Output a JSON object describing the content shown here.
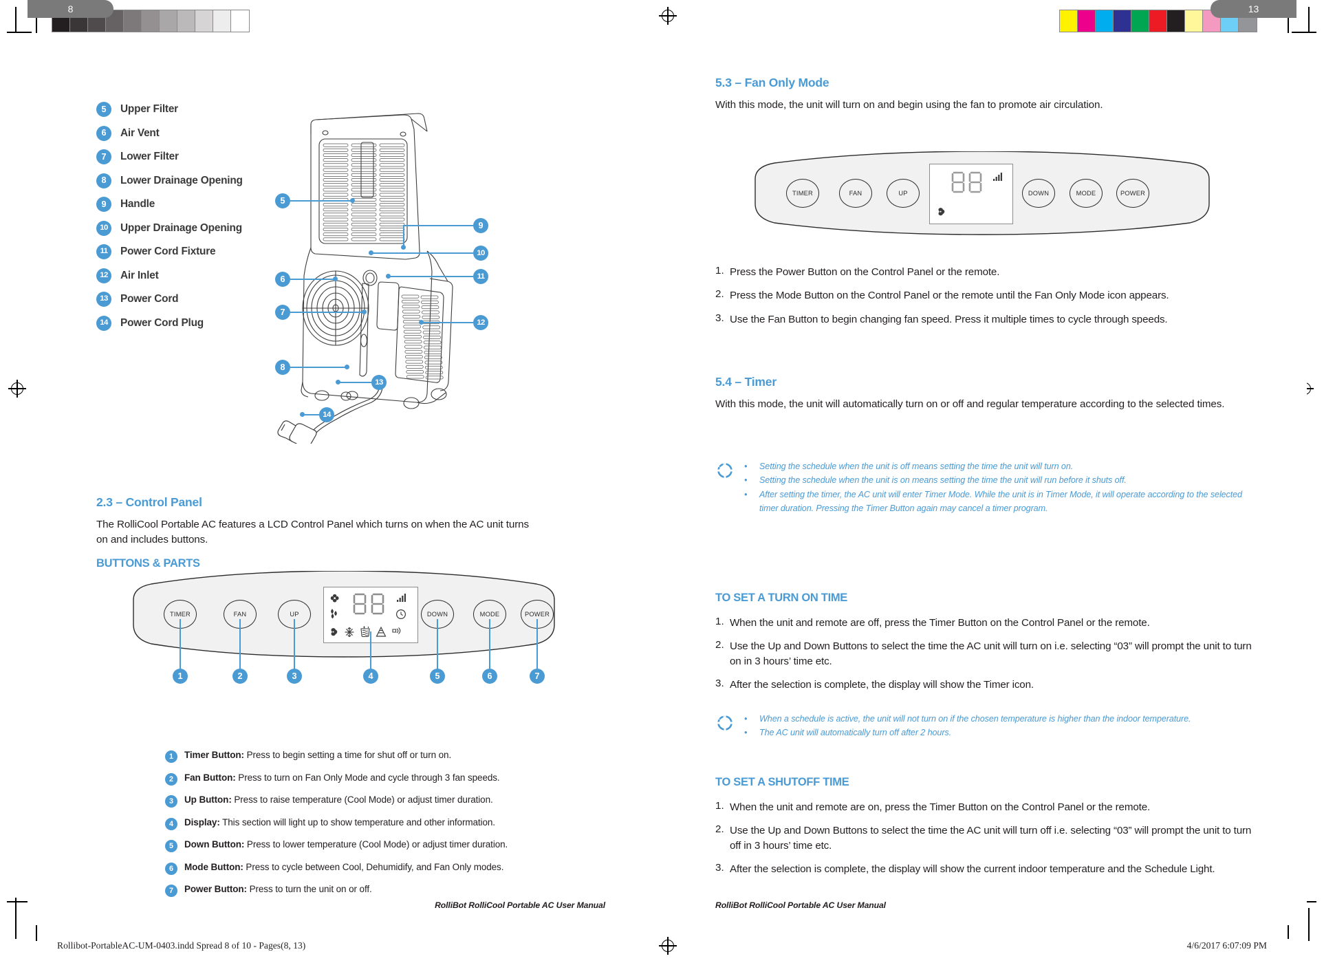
{
  "document": {
    "manual_name": "RolliBot RolliCool Portable AC User Manual",
    "left_page_number": "8",
    "right_page_number": "13",
    "print_file": "Rollibot-PortableAC-UM-0403.indd   Spread 8 of 10 - Pages(8, 13)",
    "print_timestamp": "4/6/2017   6:07:09 PM",
    "accent_color": "#4a9ad4",
    "text_color": "#231f20"
  },
  "press_marks": {
    "gray_swatches": [
      "#231f20",
      "#3a3637",
      "#4f4b4c",
      "#666263",
      "#7d797a",
      "#949091",
      "#aaa7a8",
      "#bcb9ba",
      "#d6d4d5",
      "#eeedee",
      "#ffffff"
    ],
    "color_swatches": [
      "#fff200",
      "#ec008c",
      "#00aeef",
      "#2e3192",
      "#00a651",
      "#ed1c24",
      "#231f20",
      "#fff799",
      "#f49ac1",
      "#6dcff6",
      "#939598"
    ]
  },
  "left_page": {
    "parts_list": [
      {
        "num": "5",
        "label": "Upper Filter"
      },
      {
        "num": "6",
        "label": "Air Vent"
      },
      {
        "num": "7",
        "label": "Lower Filter"
      },
      {
        "num": "8",
        "label": "Lower Drainage Opening"
      },
      {
        "num": "9",
        "label": "Handle"
      },
      {
        "num": "10",
        "label": "Upper Drainage Opening"
      },
      {
        "num": "11",
        "label": "Power Cord Fixture"
      },
      {
        "num": "12",
        "label": "Air Inlet"
      },
      {
        "num": "13",
        "label": "Power Cord"
      },
      {
        "num": "14",
        "label": "Power Cord Plug"
      }
    ],
    "diagram_callouts": [
      "5",
      "6",
      "7",
      "8",
      "9",
      "10",
      "11",
      "12",
      "13",
      "14"
    ],
    "section": {
      "heading": "2.3 – Control Panel",
      "intro": "The RolliCool Portable AC features a LCD Control Panel which turns on when the AC unit turns on and includes buttons.",
      "subheading": "BUTTONS & PARTS"
    },
    "control_panel": {
      "buttons": [
        "TIMER",
        "FAN",
        "UP",
        "DOWN",
        "MODE",
        "POWER"
      ],
      "display_digits": "88",
      "callout_numbers": [
        "1",
        "2",
        "3",
        "4",
        "5",
        "6",
        "7"
      ],
      "display_icons_top": [
        "fan-icon",
        "droplet-icon",
        "signal-bars-icon",
        "clock-icon"
      ],
      "display_icons_bottom": [
        "fan-mode-icon",
        "snowflake-icon",
        "dehumidify-icon",
        "filter-icon",
        "sleep-icon"
      ]
    },
    "legend": [
      {
        "num": "1",
        "title": "Timer Button:",
        "desc": " Press to begin setting a time for shut off or turn on."
      },
      {
        "num": "2",
        "title": "Fan Button:",
        "desc": " Press to turn on Fan Only Mode and cycle through 3 fan speeds."
      },
      {
        "num": "3",
        "title": "Up Button:",
        "desc": " Press to raise temperature (Cool Mode) or adjust timer duration."
      },
      {
        "num": "4",
        "title": "Display:",
        "desc": " This section will light up to show temperature and other information."
      },
      {
        "num": "5",
        "title": "Down Button:",
        "desc": " Press to lower temperature (Cool Mode) or adjust timer duration."
      },
      {
        "num": "6",
        "title": "Mode Button:",
        "desc": " Press to cycle between Cool, Dehumidify, and Fan Only modes."
      },
      {
        "num": "7",
        "title": "Power Button:",
        "desc": " Press to turn the unit on or off."
      }
    ]
  },
  "right_page": {
    "fan_only": {
      "heading": "5.3 – Fan Only Mode",
      "intro": "With this mode, the unit will turn on and begin using the fan to promote air circulation.",
      "panel": {
        "buttons": [
          "TIMER",
          "FAN",
          "UP",
          "DOWN",
          "MODE",
          "POWER"
        ],
        "display_digits": "88",
        "display_icons": [
          "signal-bars-icon",
          "fan-mode-icon"
        ]
      },
      "steps": [
        {
          "num": "1.",
          "text": "Press the Power Button on the Control Panel or the remote."
        },
        {
          "num": "2.",
          "text": "Press the Mode Button on the Control Panel or the remote until the Fan Only Mode icon appears."
        },
        {
          "num": "3.",
          "text": "Use the Fan Button to begin changing fan speed. Press it multiple times to cycle through speeds."
        }
      ]
    },
    "timer": {
      "heading": "5.4 – Timer",
      "intro": "With this mode, the unit will automatically turn on or off and regular temperature according to the selected times.",
      "notes": [
        "Setting the schedule when the unit is off means setting the time the unit will turn on.",
        " Setting the schedule when the unit is on means setting the time the unit will run before it shuts off.",
        " After setting the timer, the AC unit will enter Timer Mode. While the unit is in Timer Mode, it will operate according to the selected timer duration. Pressing the Timer Button again may cancel a timer program."
      ]
    },
    "turn_on": {
      "heading": "TO SET A TURN ON TIME",
      "steps": [
        {
          "num": "1.",
          "text": "When the unit and remote are off, press the Timer Button on the Control Panel or the remote."
        },
        {
          "num": "2.",
          "text": "Use the Up and Down Buttons to select the time the AC unit will turn on i.e. selecting “03” will prompt the unit to turn on in 3 hours’ time etc."
        },
        {
          "num": "3.",
          "text": "After the selection is complete, the display will show the Timer icon."
        }
      ],
      "notes": [
        "When a schedule is active, the unit will not turn on if the chosen temperature is higher than the indoor temperature.",
        "The AC unit will automatically turn off after 2 hours."
      ]
    },
    "shutoff": {
      "heading": "TO SET A SHUTOFF TIME",
      "steps": [
        {
          "num": "1.",
          "text": "When the unit and remote are on, press the Timer Button on the Control Panel or the remote."
        },
        {
          "num": "2.",
          "text": "Use the Up and Down Buttons to select the time the AC unit will turn off i.e. selecting “03” will prompt the unit to turn off in 3 hours’ time etc."
        },
        {
          "num": "3.",
          "text": "After the selection is complete, the display will show the current indoor temperature and the Schedule Light."
        }
      ]
    }
  }
}
